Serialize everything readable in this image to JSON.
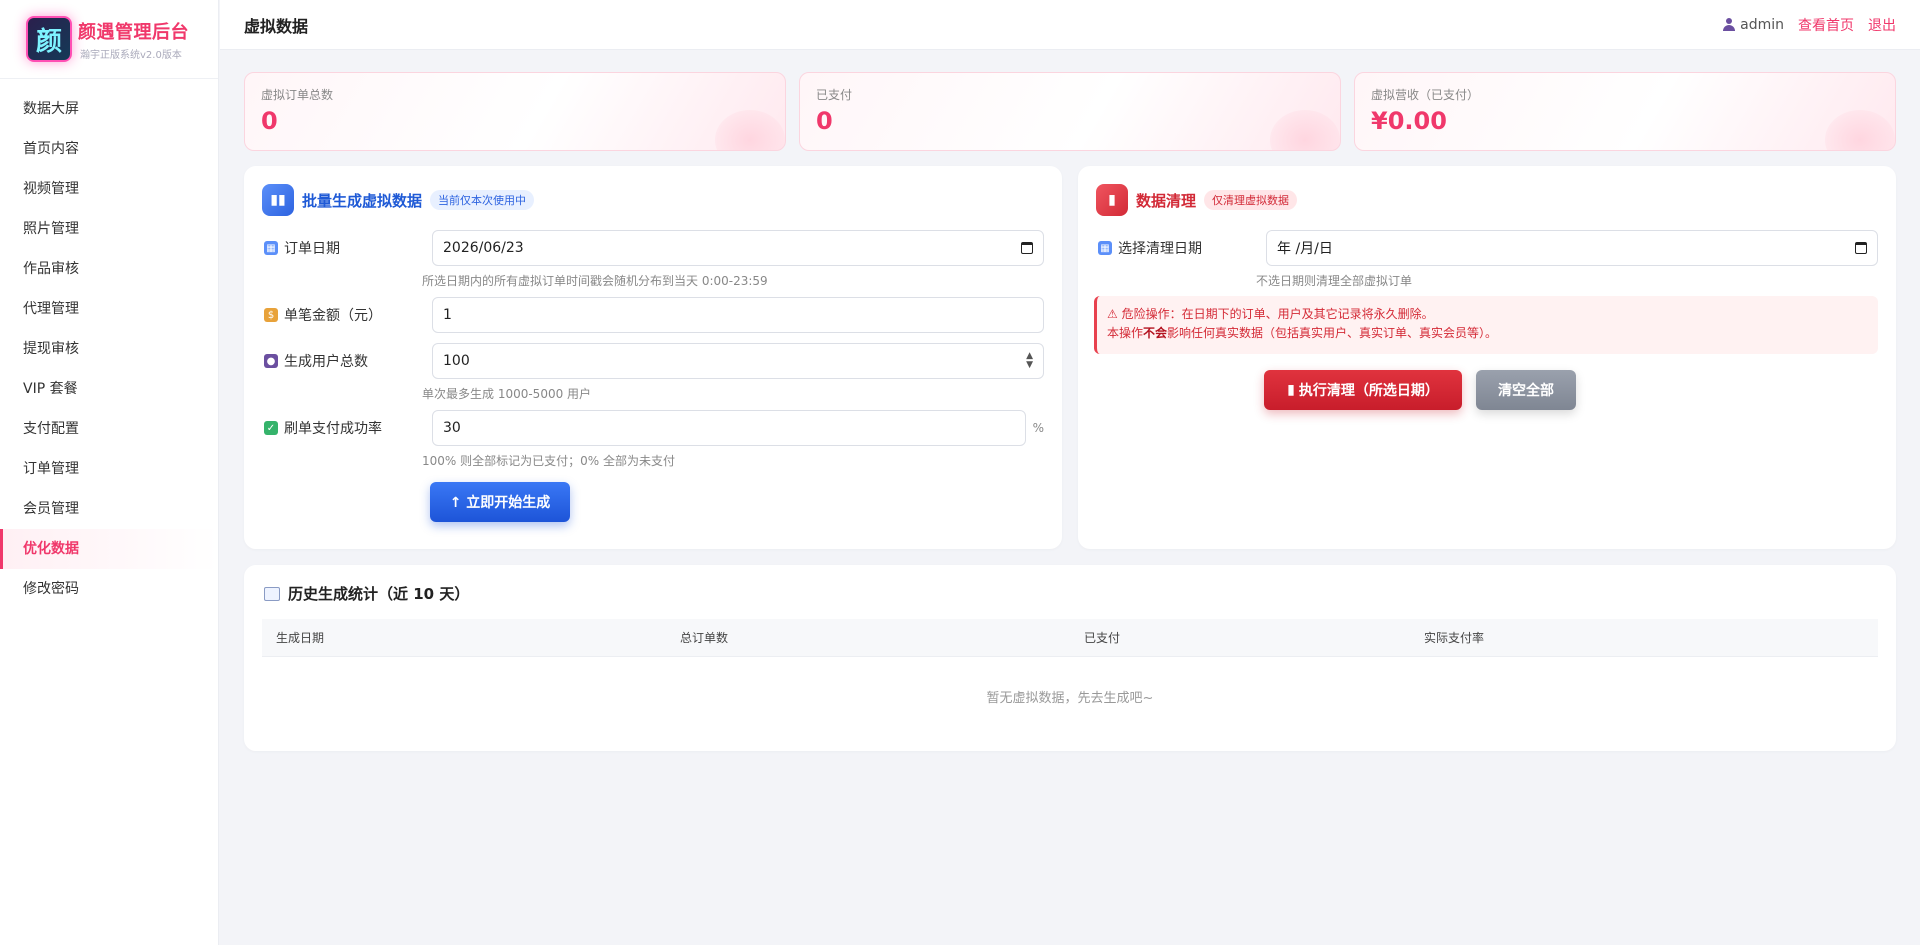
{
  "brand": {
    "title": "颜遇管理后台",
    "subtitle": "瀚宇正版系统v2.0版本",
    "logo_glyph": "颜"
  },
  "sidebar": {
    "items": [
      {
        "label": "数据大屏"
      },
      {
        "label": "首页内容"
      },
      {
        "label": "视频管理"
      },
      {
        "label": "照片管理"
      },
      {
        "label": "作品审核"
      },
      {
        "label": "代理管理"
      },
      {
        "label": "提现审核"
      },
      {
        "label": "VIP 套餐"
      },
      {
        "label": "支付配置"
      },
      {
        "label": "订单管理"
      },
      {
        "label": "会员管理"
      },
      {
        "label": "优化数据",
        "active": true
      },
      {
        "label": "修改密码"
      }
    ]
  },
  "header": {
    "title": "虚拟数据",
    "user": "admin",
    "view_home": "查看首页",
    "logout": "退出"
  },
  "stats": [
    {
      "label": "虚拟订单总数",
      "value": "0"
    },
    {
      "label": "已支付",
      "value": "0"
    },
    {
      "label": "虚拟营收（已支付）",
      "value": "¥0.00"
    }
  ],
  "generate": {
    "title": "批量生成虚拟数据",
    "badge": "当前仅本次使用中",
    "order_date_label": "订单日期",
    "order_date_value": "2026/06/23",
    "order_date_hint": "所选日期内的所有虚拟订单时间戳会随机分布到当天 0:00-23:59",
    "amount_label": "单笔金额（元）",
    "amount_value": "1",
    "users_label": "生成用户总数",
    "users_value": "100",
    "users_hint": "单次最多生成 1000-5000 用户",
    "rate_label": "刷单支付成功率",
    "rate_value": "30",
    "rate_unit": "%",
    "rate_hint": "100% 则全部标记为已支付；0% 全部为未支付",
    "submit_label": "↑ 立即开始生成"
  },
  "clear": {
    "title": "数据清理",
    "badge": "仅清理虚拟数据",
    "date_label": "选择清理日期",
    "date_placeholder": "年 /月/日",
    "date_hint": "不选日期则清理全部虚拟订单",
    "warn_line1": "⚠ 危险操作：在日期下的订单、用户及其它记录将永久删除。",
    "warn_line2_prefix": "本操作",
    "warn_line2_bold": "不会",
    "warn_line2_suffix": "影响任何真实数据（包括真实用户、真实订单、真实会员等）。",
    "exec_label": "执行清理（所选日期）",
    "clear_all_label": "清空全部"
  },
  "history": {
    "title": "历史生成统计（近 10 天）",
    "columns": [
      "生成日期",
      "总订单数",
      "已支付",
      "实际支付率"
    ],
    "empty": "暂无虚拟数据，先去生成吧~"
  }
}
